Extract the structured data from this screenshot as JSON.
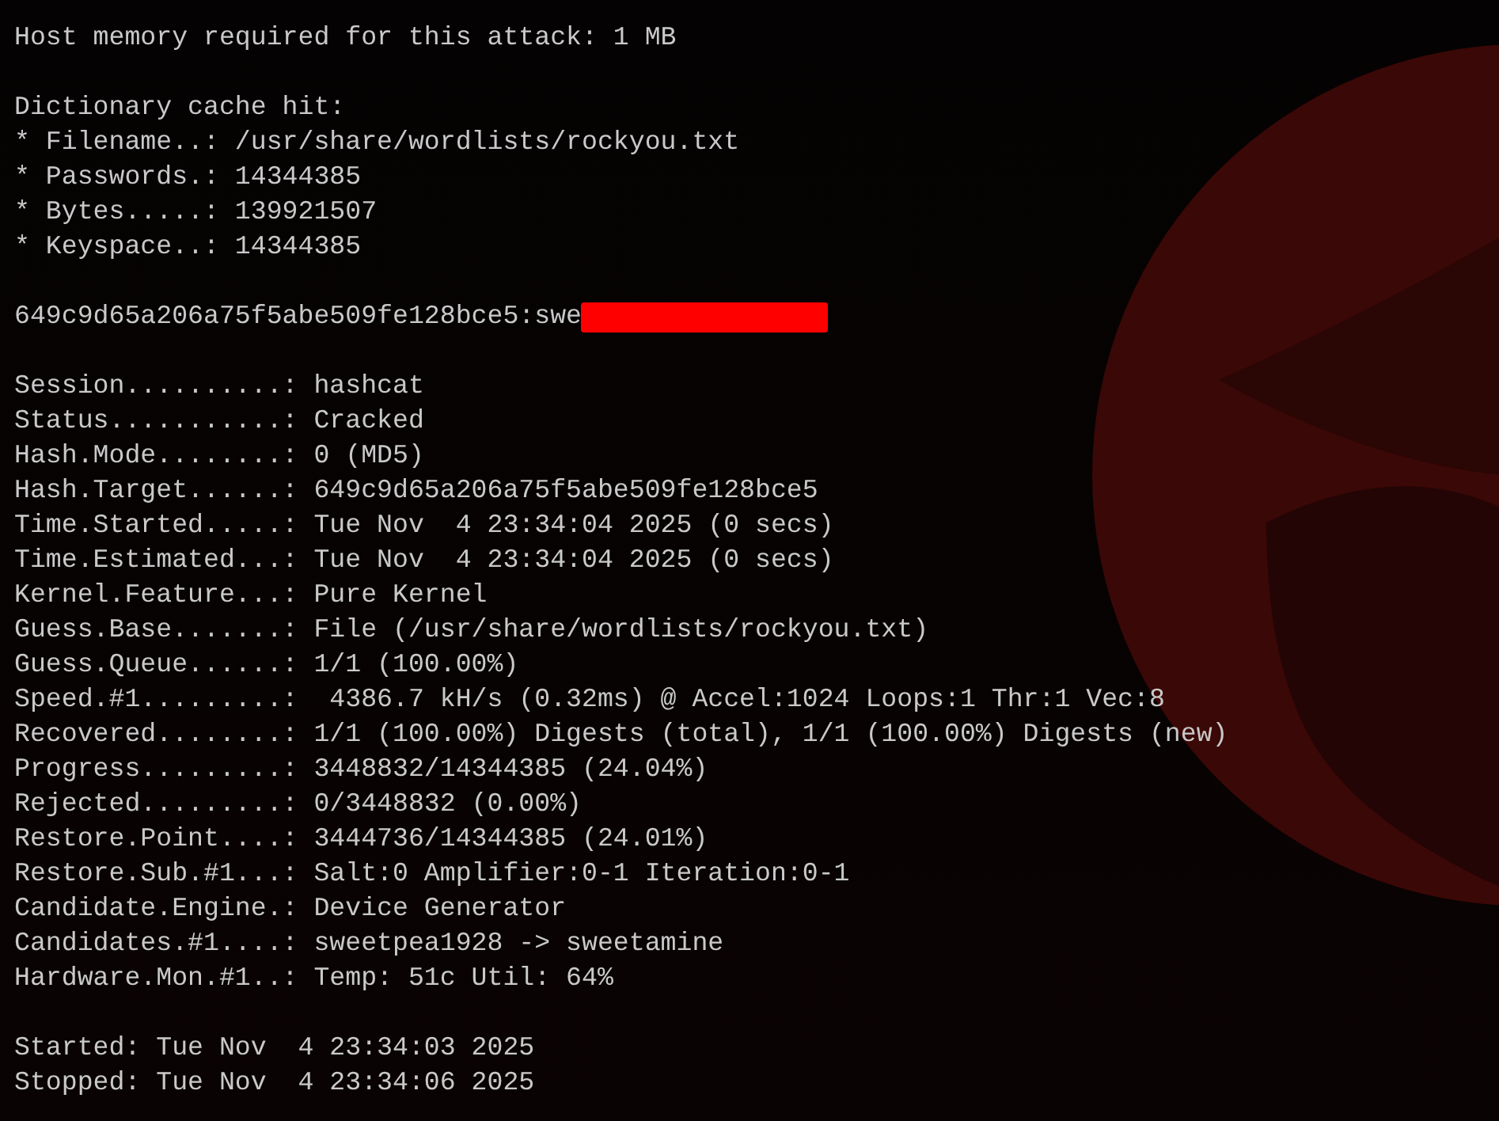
{
  "terminal": {
    "lines": [
      {
        "kind": "text",
        "text": "Host memory required for this attack: 1 MB"
      },
      {
        "kind": "blank"
      },
      {
        "kind": "text",
        "text": "Dictionary cache hit:"
      },
      {
        "kind": "text",
        "text": "* Filename..: /usr/share/wordlists/rockyou.txt"
      },
      {
        "kind": "text",
        "text": "* Passwords.: 14344385"
      },
      {
        "kind": "text",
        "text": "* Bytes.....: 139921507"
      },
      {
        "kind": "text",
        "text": "* Keyspace..: 14344385"
      },
      {
        "kind": "blank"
      },
      {
        "kind": "redacted",
        "text": "649c9d65a206a75f5abe509fe128bce5:swe"
      },
      {
        "kind": "blank"
      },
      {
        "kind": "text",
        "text": "Session..........: hashcat"
      },
      {
        "kind": "text",
        "text": "Status...........: Cracked"
      },
      {
        "kind": "text",
        "text": "Hash.Mode........: 0 (MD5)"
      },
      {
        "kind": "text",
        "text": "Hash.Target......: 649c9d65a206a75f5abe509fe128bce5"
      },
      {
        "kind": "text",
        "text": "Time.Started.....: Tue Nov  4 23:34:04 2025 (0 secs)"
      },
      {
        "kind": "text",
        "text": "Time.Estimated...: Tue Nov  4 23:34:04 2025 (0 secs)"
      },
      {
        "kind": "text",
        "text": "Kernel.Feature...: Pure Kernel"
      },
      {
        "kind": "text",
        "text": "Guess.Base.......: File (/usr/share/wordlists/rockyou.txt)"
      },
      {
        "kind": "text",
        "text": "Guess.Queue......: 1/1 (100.00%)"
      },
      {
        "kind": "text",
        "text": "Speed.#1.........:  4386.7 kH/s (0.32ms) @ Accel:1024 Loops:1 Thr:1 Vec:8"
      },
      {
        "kind": "text",
        "text": "Recovered........: 1/1 (100.00%) Digests (total), 1/1 (100.00%) Digests (new)"
      },
      {
        "kind": "text",
        "text": "Progress.........: 3448832/14344385 (24.04%)"
      },
      {
        "kind": "text",
        "text": "Rejected.........: 0/3448832 (0.00%)"
      },
      {
        "kind": "text",
        "text": "Restore.Point....: 3444736/14344385 (24.01%)"
      },
      {
        "kind": "text",
        "text": "Restore.Sub.#1...: Salt:0 Amplifier:0-1 Iteration:0-1"
      },
      {
        "kind": "text",
        "text": "Candidate.Engine.: Device Generator"
      },
      {
        "kind": "text",
        "text": "Candidates.#1....: sweetpea1928 -> sweetamine"
      },
      {
        "kind": "text",
        "text": "Hardware.Mon.#1..: Temp: 51c Util: 64%"
      },
      {
        "kind": "blank"
      },
      {
        "kind": "text",
        "text": "Started: Tue Nov  4 23:34:03 2025"
      },
      {
        "kind": "text",
        "text": "Stopped: Tue Nov  4 23:34:06 2025"
      }
    ]
  }
}
